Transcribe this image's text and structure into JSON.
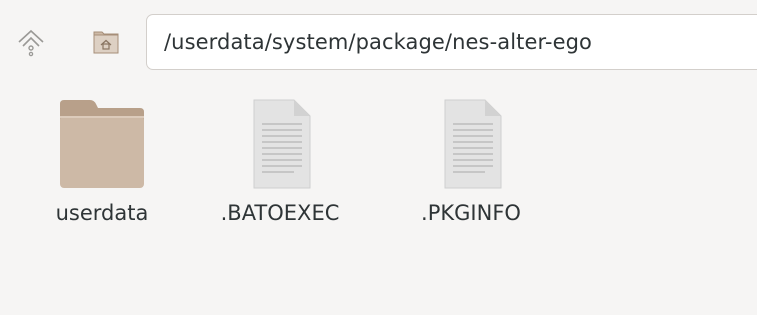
{
  "toolbar": {
    "up_icon": "go-up-icon",
    "home_icon": "home-folder-icon",
    "path": "/userdata/system/package/nes-alter-ego"
  },
  "files": [
    {
      "name": "userdata",
      "icon": "folder-icon"
    },
    {
      "name": ".BATOEXEC",
      "icon": "text-file-icon"
    },
    {
      "name": ".PKGINFO",
      "icon": "text-file-icon"
    }
  ],
  "colors": {
    "folder": "#cdb9a6",
    "folder_dark": "#b8a08a",
    "background": "#f6f5f4",
    "text": "#2e3436"
  }
}
